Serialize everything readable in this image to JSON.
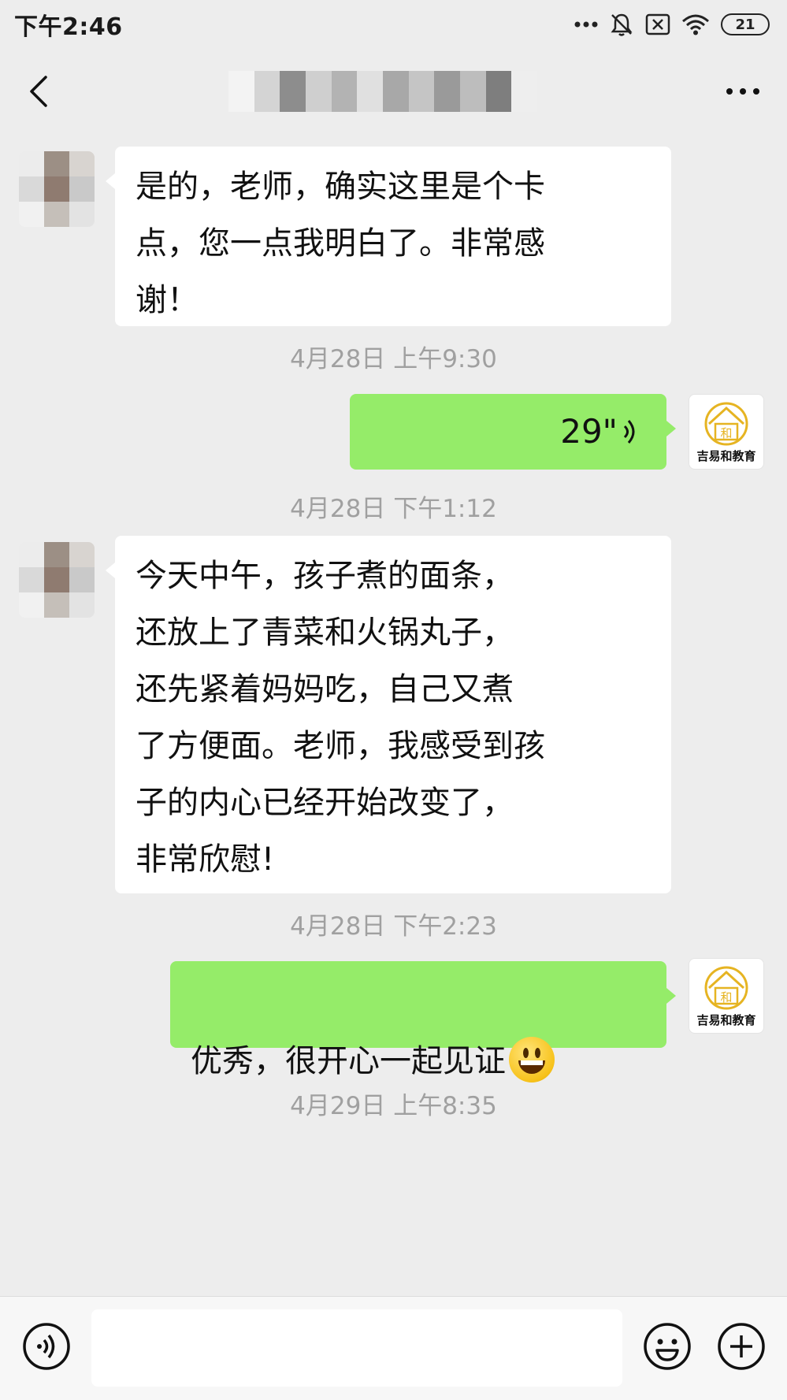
{
  "status_bar": {
    "time": "下午2:46",
    "battery": "21",
    "icons": [
      "more-dots-icon",
      "mute-icon",
      "sim-blocked-icon",
      "wifi-icon",
      "battery-icon"
    ]
  },
  "header": {
    "back_icon": "chevron-left-icon",
    "more_icon": "more-horizontal-icon"
  },
  "messages": [
    {
      "side": "left",
      "type": "text",
      "text": "是的，老师，确实这里是个卡\n点，您一点我明白了。非常感\n谢！"
    },
    {
      "type": "timestamp",
      "text": "4月28日  上午9:30"
    },
    {
      "side": "right",
      "type": "voice",
      "duration": "29\""
    },
    {
      "type": "timestamp",
      "text": "4月28日  下午1:12"
    },
    {
      "side": "left",
      "type": "text",
      "text": "今天中午，孩子煮的面条，\n还放上了青菜和火锅丸子，\n还先紧着妈妈吃，自己又煮\n了方便面。老师，我感受到孩\n子的内心已经开始改变了，\n非常欣慰!"
    },
    {
      "type": "timestamp",
      "text": "4月28日  下午2:23"
    },
    {
      "side": "right",
      "type": "text",
      "text": "优秀，很开心一起见证",
      "emoji": "grinning-face-emoji"
    },
    {
      "type": "timestamp",
      "text": "4月29日  上午8:35"
    }
  ],
  "sender_logo": {
    "text": "吉易和教育",
    "mark": "和"
  },
  "input_bar": {
    "voice_icon": "voice-input-icon",
    "emoji_icon": "emoji-icon",
    "add_icon": "plus-circle-icon",
    "placeholder": ""
  },
  "colors": {
    "background": "#ededed",
    "bubble_self": "#95ec69",
    "bubble_other": "#ffffff",
    "timestamp": "#a0a0a0",
    "logo_gold": "#e6b422"
  }
}
